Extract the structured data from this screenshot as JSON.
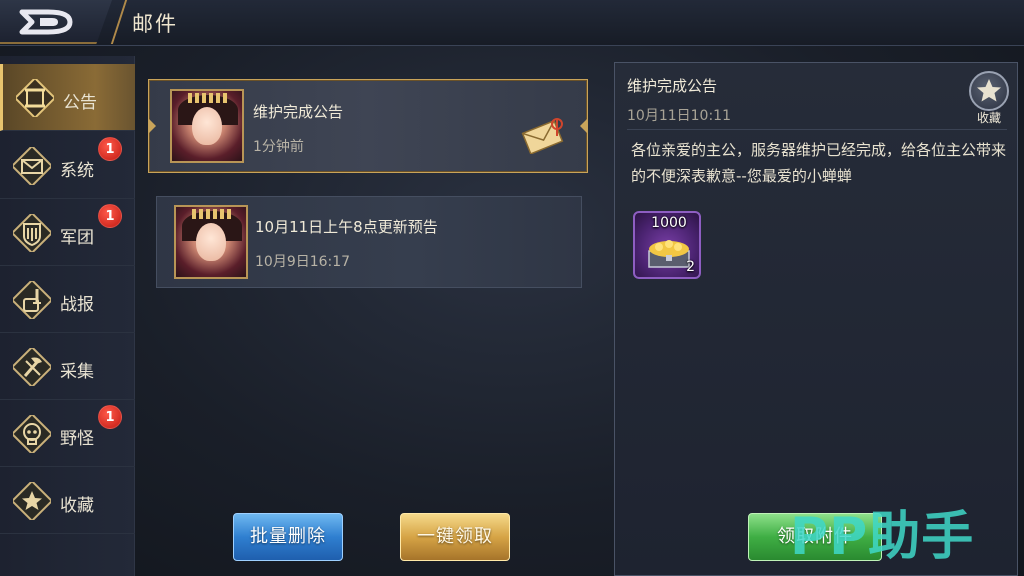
{
  "header": {
    "title": "邮件"
  },
  "sidebar": {
    "items": [
      {
        "label": "公告",
        "badge": ""
      },
      {
        "label": "系统",
        "badge": "1"
      },
      {
        "label": "军团",
        "badge": "1"
      },
      {
        "label": "战报",
        "badge": ""
      },
      {
        "label": "采集",
        "badge": ""
      },
      {
        "label": "野怪",
        "badge": "1"
      },
      {
        "label": "收藏",
        "badge": ""
      }
    ]
  },
  "mail_list": [
    {
      "title": "维护完成公告",
      "time": "1分钟前",
      "selected": true
    },
    {
      "title": "10月11日上午8点更新预告",
      "time": "10月9日16:17",
      "selected": false
    }
  ],
  "buttons": {
    "batch_delete": "批量删除",
    "claim_all": "一键领取",
    "claim_attachment": "领取附件"
  },
  "detail": {
    "title": "维护完成公告",
    "date": "10月11日10:11",
    "favorite_label": "收藏",
    "body": "各位亲爱的主公，服务器维护已经完成，给各位主公带来的不便深表歉意--您最爱的小蝉蝉",
    "reward": {
      "amount": "1000",
      "count": "2"
    }
  },
  "watermark": "PP助手",
  "colors": {
    "accent_gold": "#c9a45a",
    "badge_red": "#d8261c",
    "btn_blue": "#2f7fd0",
    "btn_gold": "#d6a446",
    "btn_green": "#3fae44"
  }
}
